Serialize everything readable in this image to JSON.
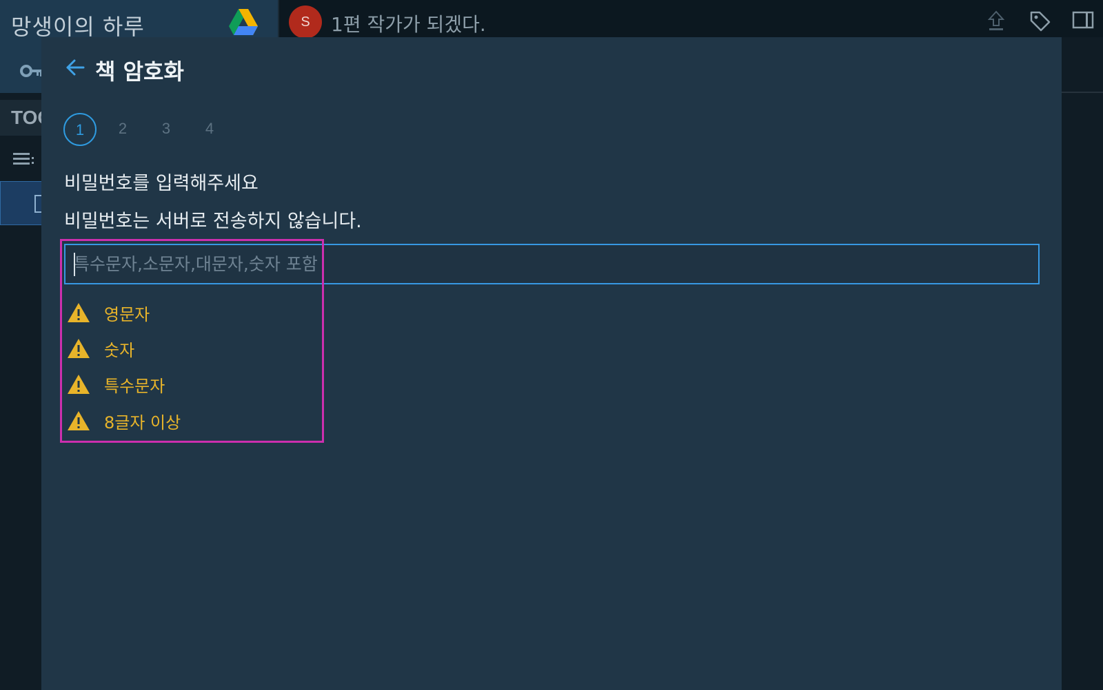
{
  "app": {
    "title": "망생이의 하루",
    "toc_label": "TOC"
  },
  "topbar": {
    "avatar_initial": "S",
    "document_title": "1편 작가가 되겠다."
  },
  "icons": {
    "drive": "google-drive-icon",
    "key": "key-icon",
    "list": "list-icon",
    "document": "document-icon",
    "upload": "upload-icon",
    "tag": "tag-icon",
    "panel": "side-panel-icon",
    "back": "back-arrow-icon",
    "warning": "warning-triangle-icon"
  },
  "modal": {
    "title": "책 암호화",
    "steps": [
      {
        "label": "1",
        "active": true
      },
      {
        "label": "2",
        "active": false
      },
      {
        "label": "3",
        "active": false
      },
      {
        "label": "4",
        "active": false
      }
    ],
    "prompt": "비밀번호를 입력해주세요",
    "notice": "비밀번호는 서버로 전송하지 않습니다.",
    "password_input": {
      "value": "",
      "placeholder": "특수문자,소문자,대문자,숫자 포함"
    },
    "requirements": [
      {
        "label": "영문자",
        "status": "warning"
      },
      {
        "label": "숫자",
        "status": "warning"
      },
      {
        "label": "특수문자",
        "status": "warning"
      },
      {
        "label": "8글자 이상",
        "status": "warning"
      }
    ]
  },
  "colors": {
    "accent": "#2f9be0",
    "warning": "#e8b42a",
    "modal_bg": "#203647",
    "highlight": "#cc2fae",
    "avatar": "#b12a1c"
  }
}
